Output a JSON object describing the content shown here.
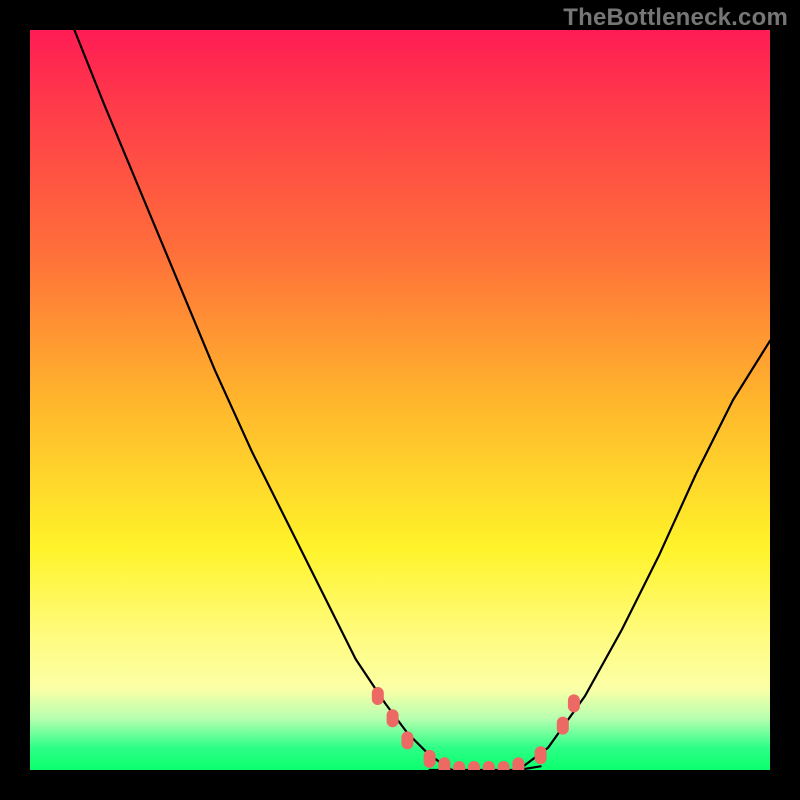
{
  "watermark": "TheBottleneck.com",
  "chart_data": {
    "type": "line",
    "title": "",
    "xlabel": "",
    "ylabel": "",
    "xlim": [
      0,
      100
    ],
    "ylim": [
      0,
      100
    ],
    "background_gradient": {
      "orientation": "vertical",
      "stops": [
        {
          "pos": 0.0,
          "color": "#ff1c54"
        },
        {
          "pos": 0.1,
          "color": "#ff3a4a"
        },
        {
          "pos": 0.3,
          "color": "#ff6f3a"
        },
        {
          "pos": 0.5,
          "color": "#ffb52c"
        },
        {
          "pos": 0.7,
          "color": "#fff32a"
        },
        {
          "pos": 0.82,
          "color": "#fffc80"
        },
        {
          "pos": 0.89,
          "color": "#fbffa6"
        },
        {
          "pos": 0.93,
          "color": "#b7ffb0"
        },
        {
          "pos": 0.97,
          "color": "#2dff86"
        },
        {
          "pos": 1.0,
          "color": "#0aff6e"
        }
      ]
    },
    "series": [
      {
        "name": "left-curve",
        "color": "#000000",
        "x": [
          6,
          10,
          15,
          20,
          25,
          30,
          35,
          40,
          44,
          48,
          51,
          54,
          57
        ],
        "y": [
          100,
          90,
          78,
          66,
          54,
          43,
          33,
          23,
          15,
          9,
          5,
          2,
          0
        ]
      },
      {
        "name": "bottom-flat",
        "color": "#000000",
        "x": [
          54,
          57,
          60,
          63,
          66,
          69
        ],
        "y": [
          0,
          0,
          0,
          0,
          0,
          0.5
        ]
      },
      {
        "name": "right-curve",
        "color": "#000000",
        "x": [
          66,
          70,
          75,
          80,
          85,
          90,
          95,
          100
        ],
        "y": [
          0,
          3,
          10,
          19,
          29,
          40,
          50,
          58
        ]
      }
    ],
    "markers": {
      "name": "salmon-dots",
      "color": "#ec6a63",
      "points": [
        {
          "x": 47,
          "y": 10
        },
        {
          "x": 49,
          "y": 7
        },
        {
          "x": 51,
          "y": 4
        },
        {
          "x": 54,
          "y": 1.5
        },
        {
          "x": 56,
          "y": 0.5
        },
        {
          "x": 58,
          "y": 0
        },
        {
          "x": 60,
          "y": 0
        },
        {
          "x": 62,
          "y": 0
        },
        {
          "x": 64,
          "y": 0
        },
        {
          "x": 66,
          "y": 0.5
        },
        {
          "x": 69,
          "y": 2
        },
        {
          "x": 72,
          "y": 6
        },
        {
          "x": 73.5,
          "y": 9
        }
      ]
    }
  }
}
